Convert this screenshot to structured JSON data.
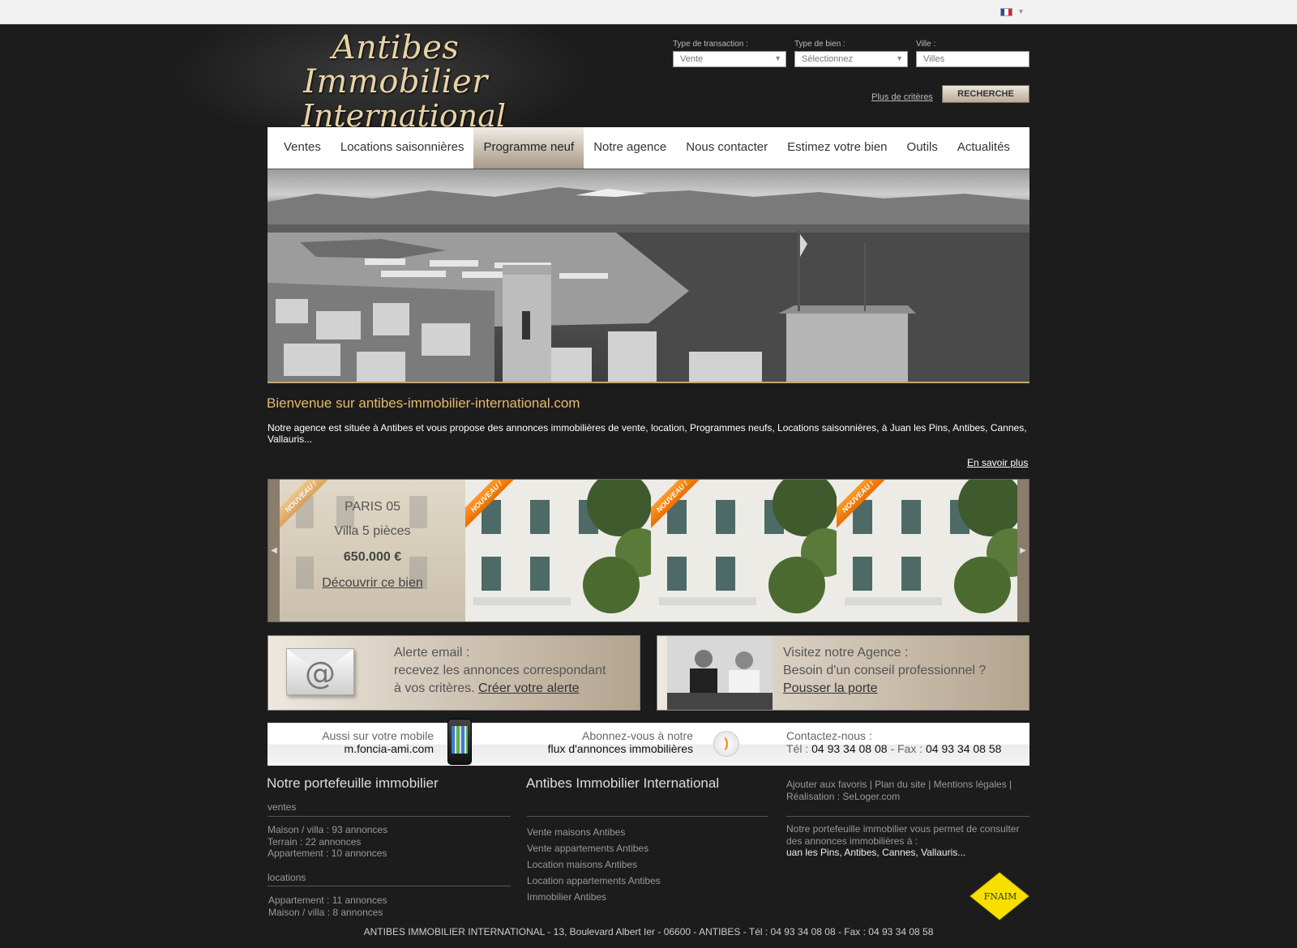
{
  "topbar": {
    "language": "FR",
    "flag_colors": [
      "#2b4aa8",
      "#ffffff",
      "#d32626"
    ]
  },
  "logo": {
    "line1": "Antibes Immobilier",
    "line2": "International"
  },
  "search": {
    "transaction_label": "Type de transaction :",
    "transaction_value": "Vente",
    "property_label": "Type de bien :",
    "property_value": "Sélectionnez",
    "city_label": "Ville :",
    "city_placeholder": "Villes",
    "more_criteria": "Plus de critères",
    "submit": "RECHERCHE"
  },
  "nav": {
    "items": [
      "Ventes",
      "Locations saisonnières",
      "Programme neuf",
      "Notre agence",
      "Nous contacter",
      "Estimez votre bien",
      "Outils",
      "Actualités"
    ],
    "active": "Programme neuf"
  },
  "welcome": {
    "title": "Bienvenue sur antibes-immobilier-international.com",
    "text": "Notre agence est située à Antibes et vous propose des annonces immobilières de vente, location, Programmes neufs, Locations saisonnières, à Juan les Pins, Antibes, Cannes, Vallauris...",
    "more": "En savoir plus"
  },
  "carousel": {
    "badge": "NOUVEAU !",
    "featured": {
      "place": "PARIS 05",
      "type": "Villa 5 pièces",
      "price": "650.000 €",
      "cta": "Découvrir ce bien"
    },
    "prev_icon": "◀",
    "next_icon": "▶"
  },
  "alert": {
    "title": "Alerte email :",
    "line2": "recevez les annonces correspondant",
    "line3": "à vos critères.",
    "link": "Créer votre alerte"
  },
  "visit": {
    "title": "Visitez notre Agence :",
    "line2": "Besoin d'un conseil professionnel ?",
    "link": "Pousser la porte"
  },
  "strip": {
    "mobile_label": "Aussi sur votre  mobile",
    "mobile_url": "m.foncia-ami.com",
    "rss_label": "Abonnez-vous à notre",
    "rss_link": "flux d'annonces immobilières",
    "contact_label": "Contactez-nous :",
    "tel_label": "Tél :",
    "tel": "04 93 34 08 08",
    "fax_label": "- Fax :",
    "fax": "04 93 34 08 58"
  },
  "portfolio": {
    "title": "Notre portefeuille immobilier",
    "sales_heading": "ventes",
    "sales": [
      "Maison / villa : 93 annonces",
      "Terrain : 22 annonces",
      "Appartement : 10 annonces"
    ],
    "rentals_heading": "locations",
    "rentals": [
      "Appartement : 11 annonces",
      "Maison / villa : 8 annonces"
    ]
  },
  "agency_col": {
    "title": "Antibes Immobilier International",
    "links": [
      "Vente maisons Antibes",
      "Vente appartements Antibes",
      "Location maisons Antibes",
      "Location appartements Antibes",
      "Immobilier Antibes"
    ]
  },
  "right_col": {
    "links_line1": "Ajouter aux favoris | Plan du site | Mentions légales |",
    "links_line2": "Réalisation : SeLoger.com",
    "desc_line1": "Notre portefeuille immobilier vous permet de consulter",
    "desc_line2": "des annonces immobilières à :",
    "desc_line3": "uan les Pins, Antibes, Cannes, Vallauris...",
    "logo_text": "FNAIM",
    "logo_color": "#f7e000"
  },
  "footer": {
    "address": "ANTIBES IMMOBILIER INTERNATIONAL - 13, Boulevard Albert Ier - 06600 - ANTIBES - Tél : 04 93 34 08 08 - Fax : 04 93 34 08 58"
  }
}
